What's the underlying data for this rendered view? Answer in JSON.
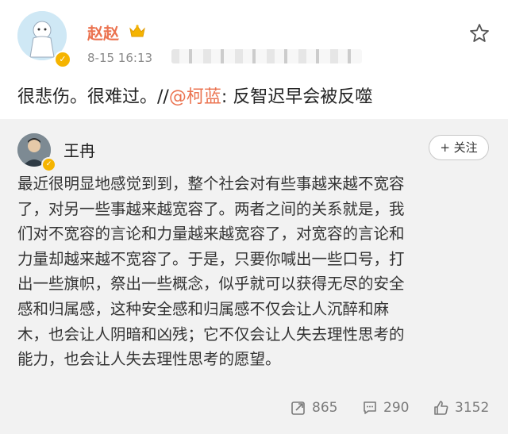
{
  "post": {
    "username": "赵赵",
    "timestamp": "8-15 16:13",
    "text_plain": "很悲伤。很难过。//",
    "mention": "@柯蓝",
    "text_after": ": 反智迟早会被反噬",
    "icons": {
      "avatar": "avatar-image",
      "verified": "verified-badge-icon",
      "vip": "crown-icon",
      "favorite": "star-icon"
    }
  },
  "retweet": {
    "username": "王冉",
    "follow_label": "+ 关注",
    "body_lines": [
      "最近很明显地感觉到到，整个社会对有些事越来越不宽容",
      "了，对另一些事越来越宽容了。两者之间的关系就是，我",
      "们对不宽容的言论和力量越来越宽容了，对宽容的言论和",
      "力量却越来越不宽容了。于是，只要你喊出一些口号，打",
      "出一些旗帜，祭出一些概念，似乎就可以获得无尽的安全",
      "感和归属感，这种安全感和归属感不仅会让人沉醉和麻",
      "木，也会让人阴暗和凶残；它不仅会让人失去理性思考的",
      "能力，也会让人失去理性思考的愿望。"
    ],
    "actions": {
      "repost_count": "865",
      "comment_count": "290",
      "like_count": "3152"
    }
  }
}
